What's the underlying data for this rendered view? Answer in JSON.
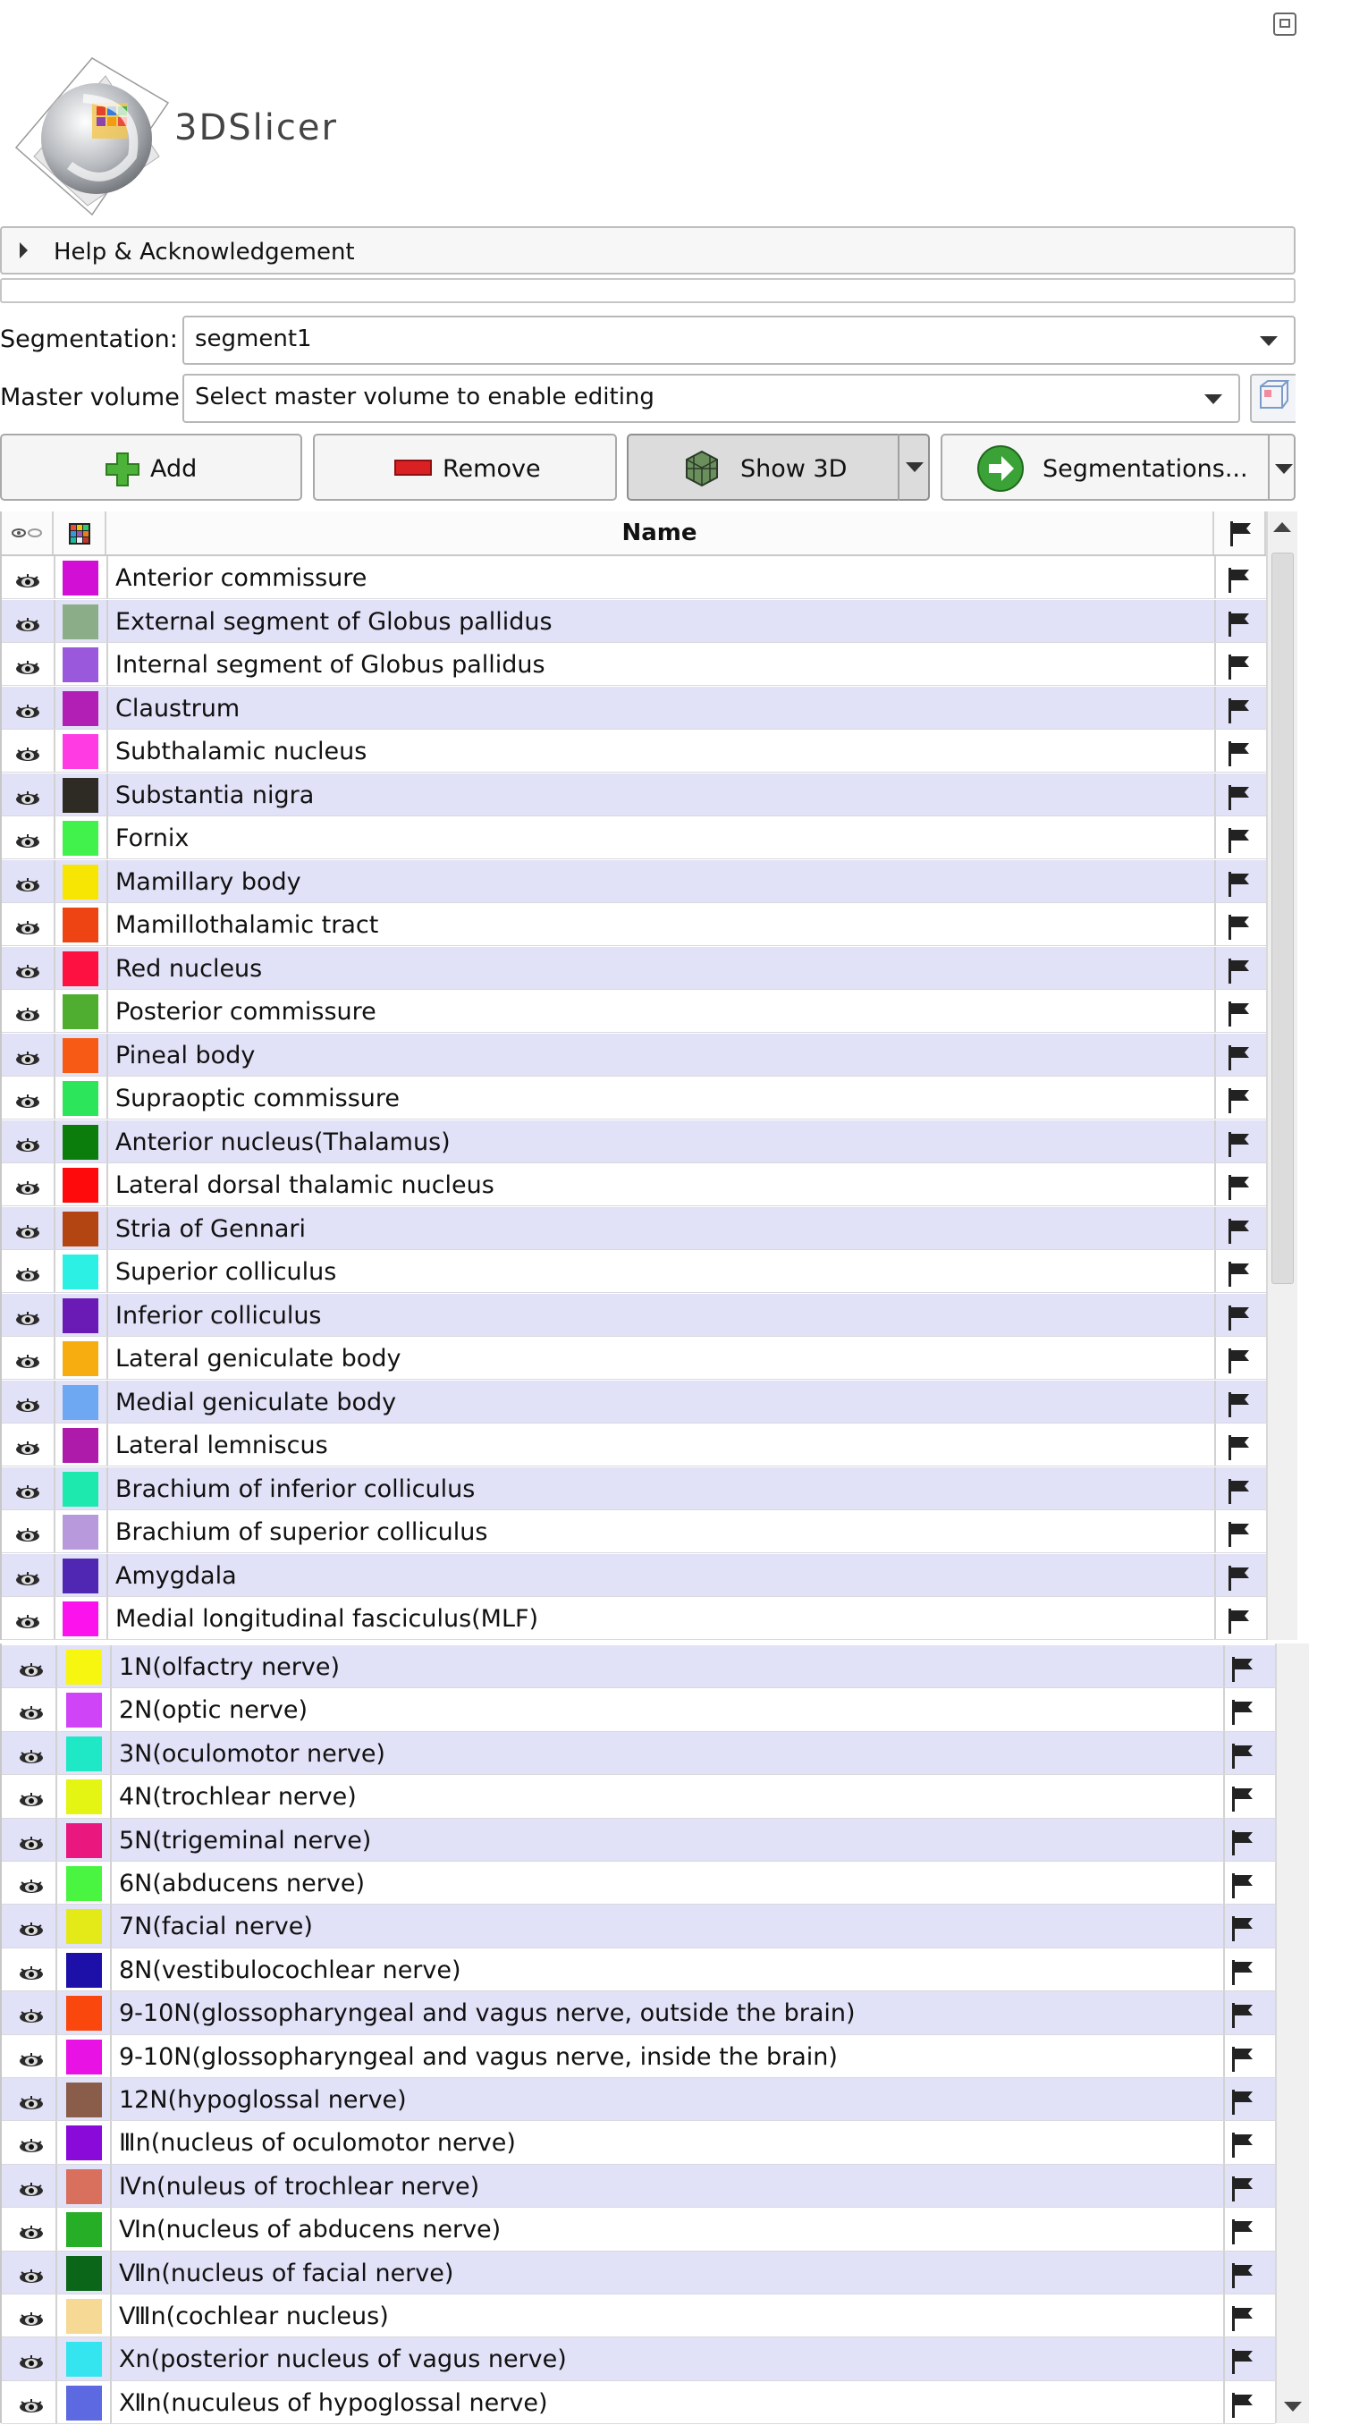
{
  "app": {
    "logo_text": "3DSlicer"
  },
  "help": {
    "label": "Help & Acknowledgement"
  },
  "segmentation": {
    "label": "Segmentation:",
    "value": "segment1"
  },
  "master_volume": {
    "label": "Master volume:",
    "value": "Select master volume to enable editing"
  },
  "buttons": {
    "add": "Add",
    "remove": "Remove",
    "show3d": "Show 3D",
    "segmentations": "Segmentations..."
  },
  "table": {
    "name_header": "Name"
  },
  "segments_top": [
    {
      "name": "Anterior commissure",
      "color": "#d10fd5"
    },
    {
      "name": "External segment of Globus pallidus",
      "color": "#8bae88"
    },
    {
      "name": "Internal segment of Globus pallidus",
      "color": "#9a58dd"
    },
    {
      "name": "Claustrum",
      "color": "#b11fb4"
    },
    {
      "name": "Subthalamic nucleus",
      "color": "#ff3be4"
    },
    {
      "name": "Substantia nigra",
      "color": "#2e2a24"
    },
    {
      "name": "Fornix",
      "color": "#41f24c"
    },
    {
      "name": "Mamillary body",
      "color": "#f7e604"
    },
    {
      "name": "Mamillothalamic tract",
      "color": "#ee4413"
    },
    {
      "name": "Red nucleus",
      "color": "#fc1140"
    },
    {
      "name": "Posterior commissure",
      "color": "#4fae30"
    },
    {
      "name": "Pineal body",
      "color": "#f75a14"
    },
    {
      "name": "Supraoptic commissure",
      "color": "#2de55b"
    },
    {
      "name": "Anterior nucleus(Thalamus)",
      "color": "#0a7d0c"
    },
    {
      "name": "Lateral dorsal thalamic nucleus",
      "color": "#fe0a0c"
    },
    {
      "name": "Stria of Gennari",
      "color": "#b24512"
    },
    {
      "name": "Superior colliculus",
      "color": "#2df0e5"
    },
    {
      "name": "Inferior colliculus",
      "color": "#6a1ab5"
    },
    {
      "name": "Lateral geniculate body",
      "color": "#f7ac10"
    },
    {
      "name": "Medial geniculate body",
      "color": "#6fa8f2"
    },
    {
      "name": "Lateral lemniscus",
      "color": "#ae1aa9"
    },
    {
      "name": "Brachium of inferior colliculus",
      "color": "#1de8ad"
    },
    {
      "name": "Brachium of superior colliculus",
      "color": "#b89adc"
    },
    {
      "name": "Amygdala",
      "color": "#5027b2"
    },
    {
      "name": "Medial longitudinal fasciculus(MLF)",
      "color": "#fb12ec"
    }
  ],
  "segments_bottom": [
    {
      "name": "1N(olfactry nerve)",
      "color": "#f7f610"
    },
    {
      "name": "2N(optic nerve)",
      "color": "#d044f7"
    },
    {
      "name": "3N(oculomotor nerve)",
      "color": "#1ee8c6"
    },
    {
      "name": "4N(trochlear nerve)",
      "color": "#e4f514"
    },
    {
      "name": "5N(trigeminal nerve)",
      "color": "#e9177e"
    },
    {
      "name": "6N(abducens nerve)",
      "color": "#4af541"
    },
    {
      "name": "7N(facial nerve)",
      "color": "#e4ea18"
    },
    {
      "name": "8N(vestibulocochlear nerve)",
      "color": "#1c10a8"
    },
    {
      "name": "9-10N(glossopharyngeal and vagus nerve, outside the brain)",
      "color": "#f9470e"
    },
    {
      "name": "9-10N(glossopharyngeal and vagus nerve, inside the brain)",
      "color": "#e812e4"
    },
    {
      "name": "12N(hypoglossal nerve)",
      "color": "#8a5d4b"
    },
    {
      "name": "Ⅲn(nucleus of oculomotor nerve)",
      "color": "#8a0bd9"
    },
    {
      "name": "Ⅳn(nuleus of trochlear nerve)",
      "color": "#d9705e"
    },
    {
      "name": "Ⅵn(nucleus of abducens nerve)",
      "color": "#25ae26"
    },
    {
      "name": "Ⅶn(nucleus of facial nerve)",
      "color": "#0b6619"
    },
    {
      "name": "Ⅷn(cochlear nucleus)",
      "color": "#f7d996"
    },
    {
      "name": "Ⅹn(posterior nucleus of vagus nerve)",
      "color": "#34e4ee"
    },
    {
      "name": "Ⅻn(nuculeus of hypoglossal nerve)",
      "color": "#5d69e0"
    }
  ]
}
